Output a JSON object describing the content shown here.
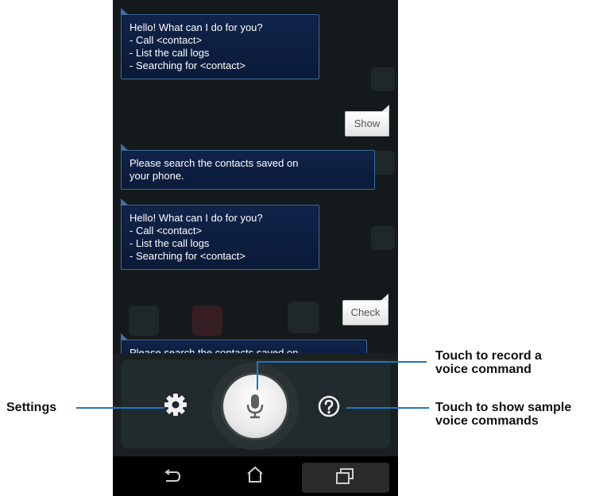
{
  "chat": {
    "messages": [
      {
        "role": "assistant",
        "lines": [
          "Hello! What can I do for you?",
          "- Call <contact>",
          "- List the call logs",
          "- Searching for <contact>"
        ]
      },
      {
        "role": "user",
        "text": "Show"
      },
      {
        "role": "assistant",
        "lines": [
          "Please search the contacts saved on",
          "your phone."
        ]
      },
      {
        "role": "assistant",
        "lines": [
          "Hello! What can I do for you?",
          "- Call <contact>",
          "- List the call logs",
          "- Searching for <contact>"
        ]
      },
      {
        "role": "user",
        "text": "Check"
      },
      {
        "role": "assistant",
        "lines": [
          "Please search the contacts saved on"
        ]
      }
    ]
  },
  "controls": {
    "settings_icon": "gear-icon",
    "mic_icon": "microphone-icon",
    "help_icon": "question-mark-icon"
  },
  "navbar": {
    "back_icon": "back-arrow-icon",
    "home_icon": "home-icon",
    "recents_icon": "recent-apps-icon"
  },
  "callouts": {
    "settings": "Settings",
    "record": "Touch to record a voice command",
    "samples": "Touch to show sample voice commands",
    "record_lines": [
      "Touch to record a",
      "voice command"
    ],
    "samples_lines": [
      "Touch to show sample",
      "voice commands"
    ]
  },
  "colors": {
    "callout_line": "#1e78c2",
    "bubble_border": "#3d6fa3",
    "bubble_fill": "#0f2247",
    "screen_bg": "#141a1c"
  }
}
